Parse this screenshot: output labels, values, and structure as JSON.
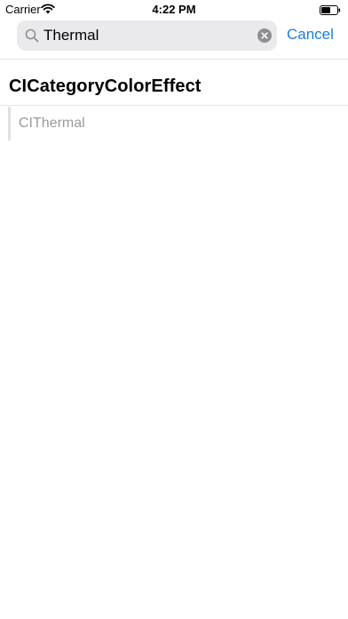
{
  "status_bar": {
    "carrier": "Carrier",
    "time": "4:22 PM",
    "wifi_icon": "wifi-icon",
    "battery_icon": "battery-icon"
  },
  "search": {
    "value": "Thermal",
    "placeholder": "",
    "search_icon": "search-icon",
    "clear_icon": "clear-icon",
    "cancel_label": "Cancel"
  },
  "results": {
    "section_title": "CICategoryColorEffect",
    "items": [
      {
        "label": "CIThermal"
      }
    ]
  },
  "colors": {
    "accent": "#1a7fd8",
    "search_field_bg": "#eaeaec",
    "result_text": "#9b9b9b"
  }
}
